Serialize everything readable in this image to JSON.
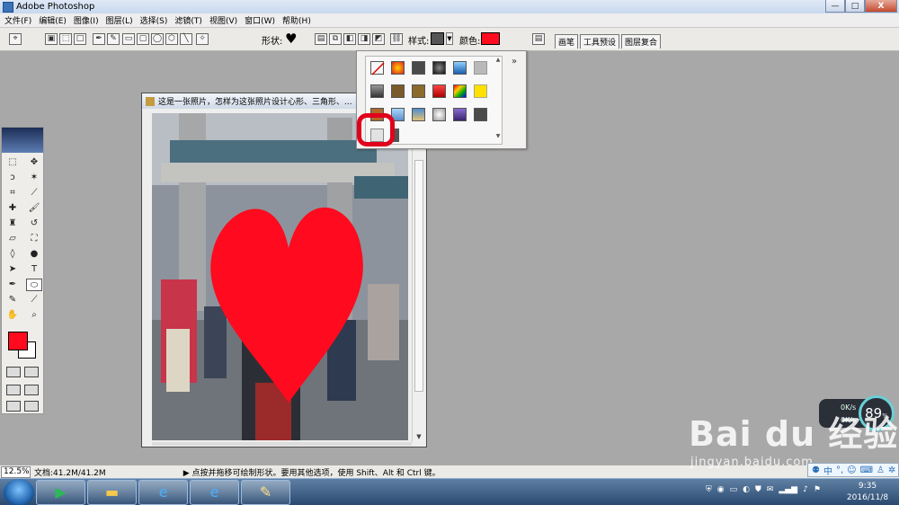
{
  "window": {
    "title": "Adobe Photoshop",
    "controls": {
      "minimize": "—",
      "maximize": "□",
      "close": "X"
    }
  },
  "menu": [
    "文件(F)",
    "编辑(E)",
    "图像(I)",
    "图层(L)",
    "选择(S)",
    "滤镜(T)",
    "视图(V)",
    "窗口(W)",
    "帮助(H)"
  ],
  "options_bar": {
    "shape_label": "形状:",
    "shape_glyph": "♥",
    "style_label": "样式:",
    "color_label": "颜色:",
    "color_value": "#ff0a1e",
    "palette_tabs": [
      "画笔",
      "工具预设",
      "图层复合"
    ]
  },
  "document": {
    "title": "这是一张照片，怎样为这张照片设计心形、三角形、..."
  },
  "style_picker": {
    "more": "»",
    "selected_index": 20,
    "highlight_color": "#e1001b",
    "styles": [
      "none",
      "orange-burst",
      "dark-gray",
      "black-chrome",
      "blue-glass",
      "light-gray",
      "#0",
      "steel",
      "bronze",
      "gold",
      "red-glass",
      "rainbow",
      "yellow-star",
      "#1",
      "copper",
      "blue-sky",
      "sky-photo",
      "purple-glass",
      "purple-gem",
      "slate",
      "#2",
      "default",
      "dark-small"
    ]
  },
  "status": {
    "zoom": "12.5%",
    "doc_size": "文档:41.2M/41.2M",
    "hint": "▶ 点按并拖移可绘制形状。要用其他选项，使用 Shift、Alt 和 Ctrl 键。"
  },
  "speed_widget": {
    "up": "0K/s",
    "down": "0K/s",
    "percent": "89",
    "percent_unit": "%"
  },
  "watermark": {
    "main": "Bai du 经验",
    "sub": "jingyan.baidu.com"
  },
  "ime": {
    "lang": "中"
  },
  "clock": {
    "time": "9:35",
    "date": "2016/11/8"
  }
}
